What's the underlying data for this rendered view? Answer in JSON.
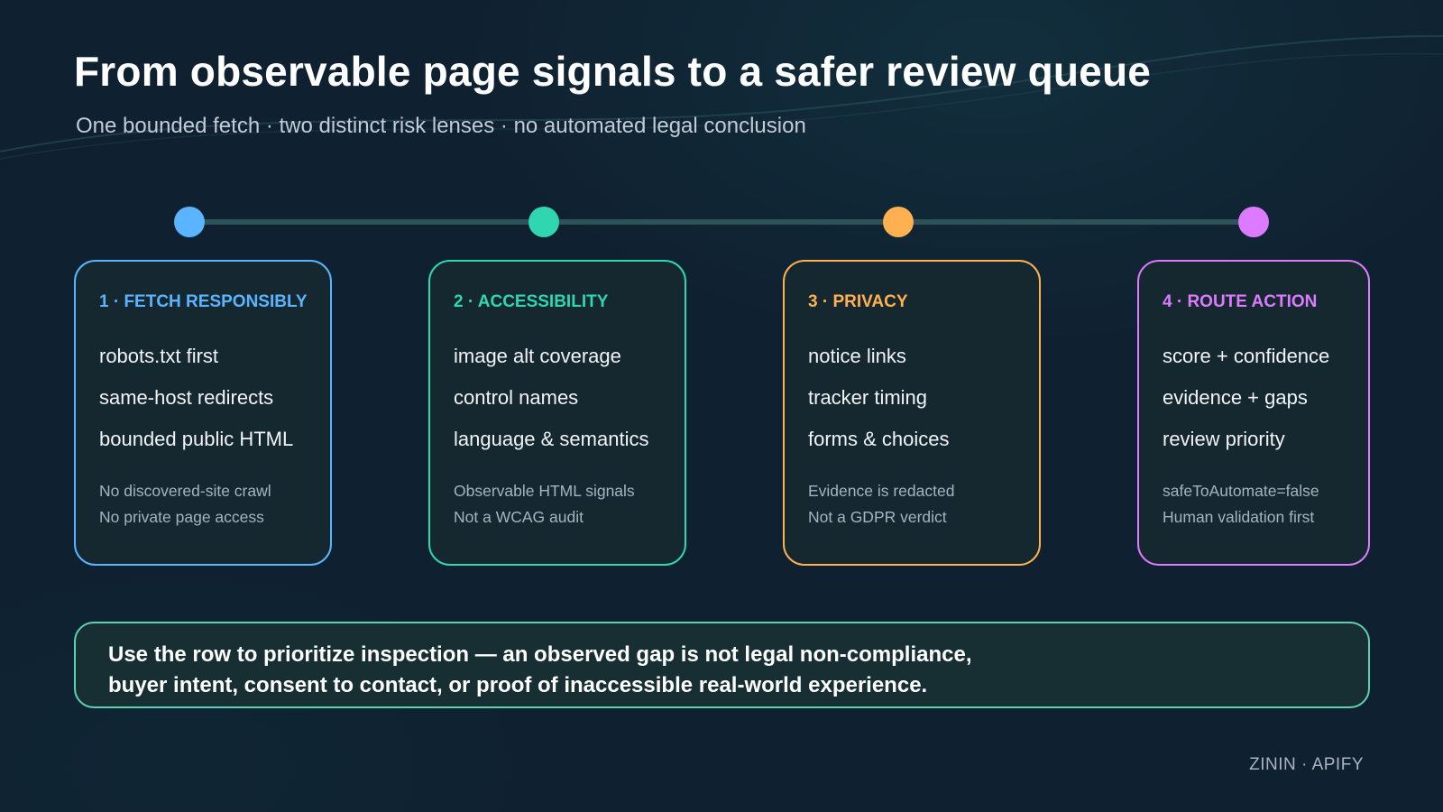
{
  "header": {
    "title": "From observable page signals to a safer review queue",
    "subtitle": "One bounded fetch · two distinct risk lenses · no automated legal conclusion"
  },
  "colors": {
    "background": "#0f2030",
    "card_background": "#15282f",
    "timeline_line": "#2d5358",
    "callout_border": "#5fd0b0",
    "fetch": "#5ab4ff",
    "accessibility": "#2fd6b0",
    "privacy": "#ffb152",
    "route": "#dc7bff"
  },
  "steps": [
    {
      "title": "1 · FETCH RESPONSIBLY",
      "color": "#5ab4ff",
      "items": [
        "robots.txt first",
        "same-host redirects",
        "bounded public HTML"
      ],
      "notes": [
        "No discovered-site crawl",
        "No private page access"
      ]
    },
    {
      "title": "2 · ACCESSIBILITY",
      "color": "#2fd6b0",
      "items": [
        "image alt coverage",
        "control names",
        "language & semantics"
      ],
      "notes": [
        "Observable HTML signals",
        "Not a WCAG audit"
      ]
    },
    {
      "title": "3 · PRIVACY",
      "color": "#ffb152",
      "items": [
        "notice links",
        "tracker timing",
        "forms & choices"
      ],
      "notes": [
        "Evidence is redacted",
        "Not a GDPR verdict"
      ]
    },
    {
      "title": "4 · ROUTE ACTION",
      "color": "#dc7bff",
      "items": [
        "score + confidence",
        "evidence + gaps",
        "review priority"
      ],
      "notes": [
        "safeToAutomate=false",
        "Human validation first"
      ]
    }
  ],
  "callout": {
    "line1": "Use the row to prioritize inspection — an observed gap is not legal non-compliance,",
    "line2": "buyer intent, consent to contact, or proof of inaccessible real-world experience."
  },
  "footer": {
    "brand": "ZININ · APIFY"
  }
}
